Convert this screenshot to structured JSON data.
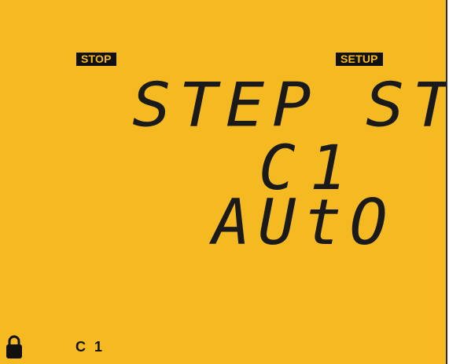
{
  "display": {
    "mode_indicator": "STOP",
    "menu_indicator": "SETUP",
    "line1": "STEP STA",
    "line2": "C1",
    "line3": "AUtO",
    "bottom_label": "C 1"
  },
  "icons": {
    "lock": "lock-icon"
  },
  "colors": {
    "lcd_background": "#F5B921",
    "segment": "#111111"
  }
}
